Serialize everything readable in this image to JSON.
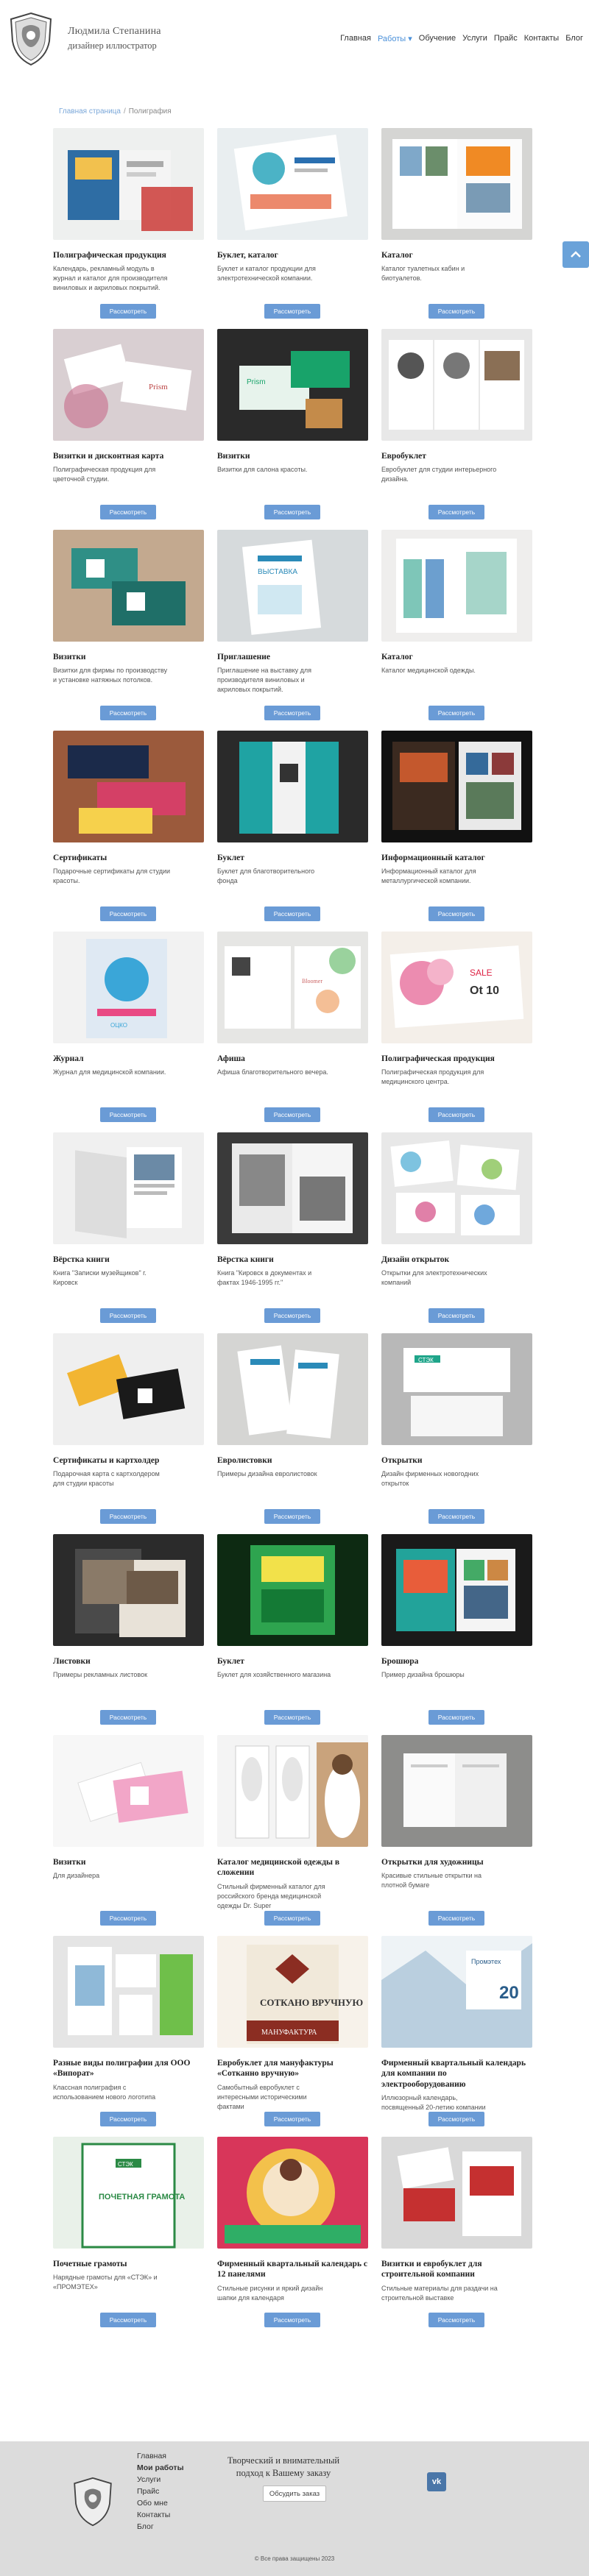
{
  "header": {
    "name": "Людмила Степанина",
    "subtitle": "дизайнер иллюстратор"
  },
  "nav": [
    "Главная",
    "Работы",
    "Обучение",
    "Услуги",
    "Прайс",
    "Контакты",
    "Блог"
  ],
  "breadcrumb": {
    "home": "Главная страница",
    "sep": "/",
    "current": "Полиграфия"
  },
  "button_label": "Рассмотреть",
  "cards": [
    {
      "title": "Полиграфическая продукция",
      "desc": "Календарь, рекламный модуль в журнал и каталог для производителя виниловых и акриловых покрытий."
    },
    {
      "title": "Буклет, каталог",
      "desc": "Буклет и каталог продукции для электротехнической компании."
    },
    {
      "title": "Каталог",
      "desc": "Каталог туалетных кабин и биотуалетов."
    },
    {
      "title": "Визитки и дисконтная карта",
      "desc": "Полиграфическая продукция для цветочной студии."
    },
    {
      "title": "Визитки",
      "desc": "Визитки для салона красоты."
    },
    {
      "title": "Евробуклет",
      "desc": "Евробуклет для студии интерьерного дизайна."
    },
    {
      "title": "Визитки",
      "desc": "Визитки для фирмы по производству и установке натяжных потолков."
    },
    {
      "title": "Приглашение",
      "desc": "Приглашение на выставку для производителя виниловых и акриловых покрытий."
    },
    {
      "title": "Каталог",
      "desc": "Каталог медицинской одежды."
    },
    {
      "title": "Сертификаты",
      "desc": "Подарочные сертификаты для студии красоты."
    },
    {
      "title": "Буклет",
      "desc": "Буклет для благотворительного фонда"
    },
    {
      "title": "Информационный каталог",
      "desc": "Информационный каталог для металлургической компании."
    },
    {
      "title": "Журнал",
      "desc": "Журнал для медицинской компании."
    },
    {
      "title": "Афиша",
      "desc": "Афиша благотворительного вечера."
    },
    {
      "title": "Полиграфическая продукция",
      "desc": "Полиграфическая продукция для медицинского центра."
    },
    {
      "title": "Вёрстка книги",
      "desc": "Книга \"Записки музейщиков\" г. Кировск"
    },
    {
      "title": "Вёрстка книги",
      "desc": "Книга \"Кировск в документах и фактах 1946-1995 гг.\""
    },
    {
      "title": "Дизайн открыток",
      "desc": "Открытки для электротехнических компаний"
    },
    {
      "title": "Сертификаты и картхолдер",
      "desc": "Подарочная карта с картхолдером для студии красоты"
    },
    {
      "title": "Евролистовки",
      "desc": "Примеры дизайна евролистовок"
    },
    {
      "title": "Открытки",
      "desc": "Дизайн фирменных новогодних открыток"
    },
    {
      "title": "Листовки",
      "desc": "Примеры рекламных листовок"
    },
    {
      "title": "Буклет",
      "desc": "Буклет для хозяйственного магазина"
    },
    {
      "title": "Брошюра",
      "desc": "Пример дизайна брошюры"
    },
    {
      "title": "Визитки",
      "desc": "Для дизайнера"
    },
    {
      "title": "Каталог медицинской одежды в сложении",
      "desc": "Стильный фирменный каталог для российского бренда медицинской одежды Dr. Super"
    },
    {
      "title": "Открытки для художницы",
      "desc": "Красивые стильные открытки на плотной бумаге"
    },
    {
      "title": "Разные виды полиграфии для ООО «Випорат»",
      "desc": "Классная полиграфия с использованием нового логотипа"
    },
    {
      "title": "Евробуклет для мануфактуры «Сотканно вручную»",
      "desc": "Самобытный евробуклет с интересными историческими фактами"
    },
    {
      "title": "Фирменный квартальный календарь для компании по электрооборудованию",
      "desc": "Иллюзорный календарь, посвященный 20-летию компании"
    },
    {
      "title": "Почетные грамоты",
      "desc": "Нарядные грамоты для «СТЭК» и «ПРОМЭТЕХ»"
    },
    {
      "title": "Фирменный квартальный календарь с 12 панелями",
      "desc": "Стильные рисунки и яркий дизайн шапки для календаря"
    },
    {
      "title": "Визитки и евробуклет для строительной компании",
      "desc": "Стильные материалы для раздачи на строительной выставке"
    }
  ],
  "footer": {
    "nav": [
      "Главная",
      "Мои работы",
      "Услуги",
      "Прайс",
      "Обо мне",
      "Контакты",
      "Блог"
    ],
    "current_index": 1,
    "text": "Творческий и внимательный подход к Вашему заказу",
    "button": "Обсудить заказ",
    "vk": "vk",
    "copyright": "© Все права защищены 2023"
  },
  "image_labels": [
    "Prism",
    "ВЫСТАВКА",
    "ОЦКО",
    "Bloomer",
    "SALE",
    "Оt 10",
    "СТЭК",
    "СТЭК",
    "СОТКАНО ВРУЧНУЮ",
    "МАНУФАКТУРА",
    "Промэтех",
    "20",
    "СТЭК",
    "ПОЧЕТНАЯ ГРАМОТА"
  ]
}
